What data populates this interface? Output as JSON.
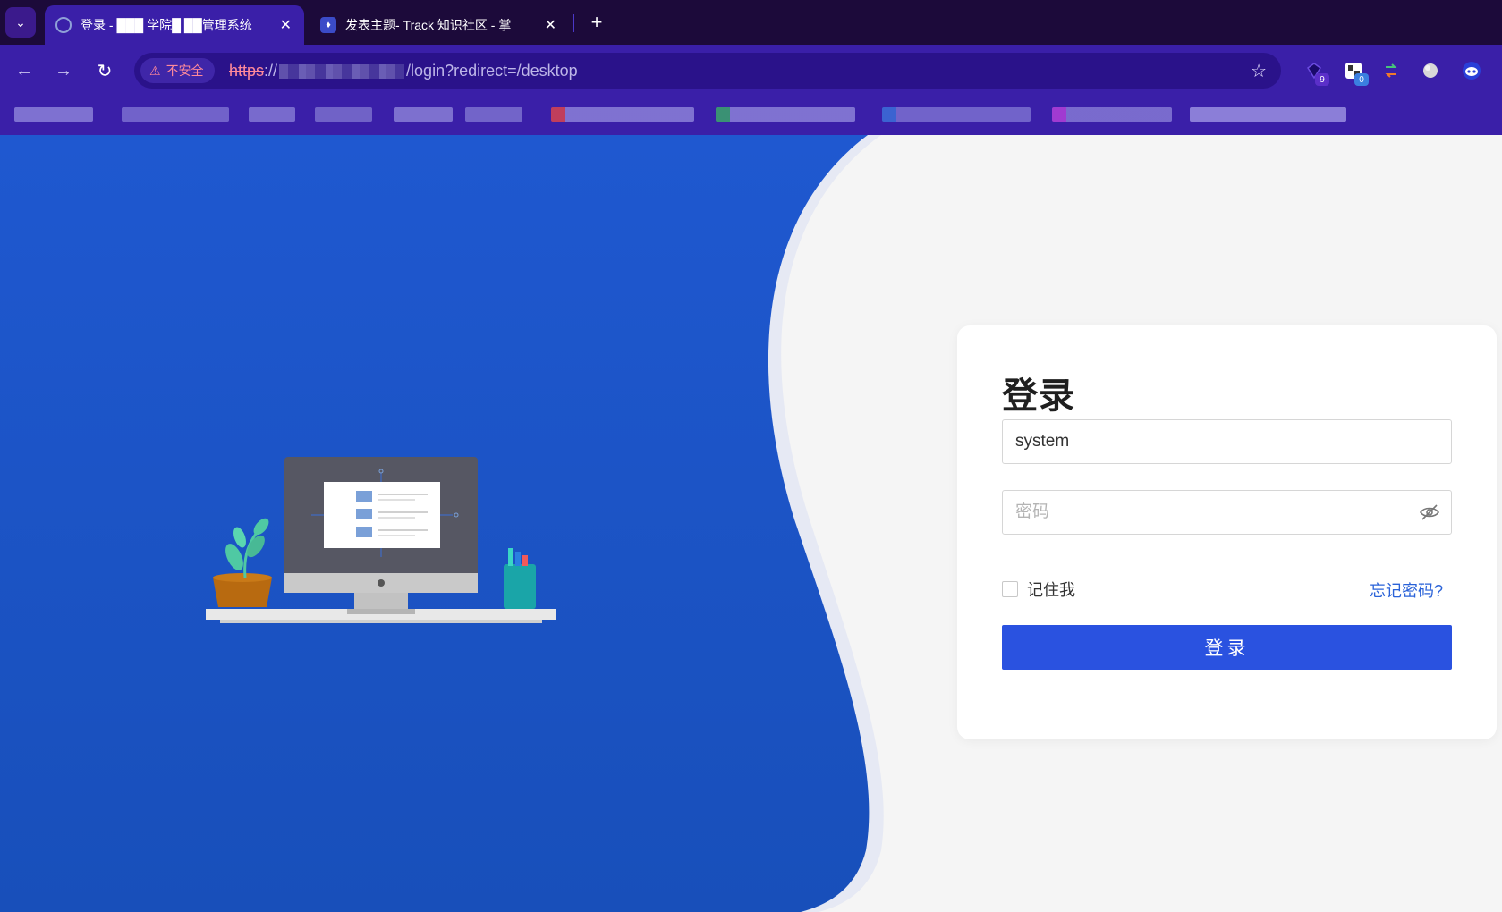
{
  "browser": {
    "tabs": [
      {
        "title": "登录 - ███ 学院█ ██管理系统",
        "active": true
      },
      {
        "title": "发表主题- Track 知识社区 - 掌",
        "active": false
      }
    ],
    "new_tab_icon": "+",
    "security_label": "不安全",
    "url": {
      "scheme": "https",
      "sep": "://",
      "path": "/login?redirect=/desktop"
    },
    "extensions": [
      {
        "icon": "gem-icon",
        "badge": "9",
        "badge_color": "#5b2fc9"
      },
      {
        "icon": "translate-icon",
        "badge": "0",
        "badge_color": "#3b7fe0"
      },
      {
        "icon": "sync-arrows-icon",
        "badge": ""
      },
      {
        "icon": "globe-icon",
        "badge": ""
      },
      {
        "icon": "robot-icon",
        "badge": ""
      }
    ]
  },
  "login": {
    "title": "登录",
    "username_value": "system",
    "password_placeholder": "密码",
    "remember_label": "记住我",
    "forgot_label": "忘记密码?",
    "submit_label": "登录"
  },
  "colors": {
    "brand_blue": "#1e55c8",
    "button_blue": "#2a52e0",
    "link_blue": "#2a62d8",
    "browser_purple": "#3a1fa8"
  }
}
